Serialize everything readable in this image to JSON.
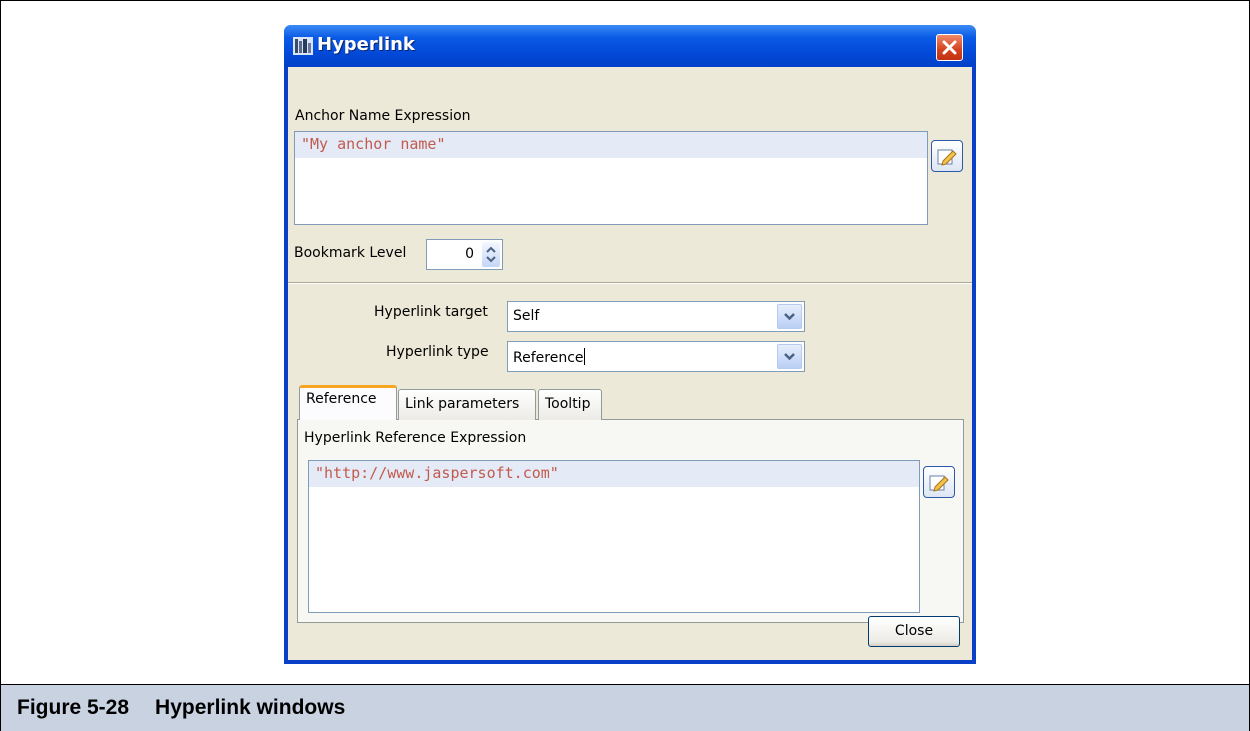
{
  "dialog": {
    "title": "Hyperlink",
    "anchor_label": "Anchor Name Expression",
    "anchor_expression": "\"My anchor name\"",
    "bookmark_label": "Bookmark Level",
    "bookmark_value": "0",
    "target_label": "Hyperlink target",
    "target_value": "Self",
    "type_label": "Hyperlink type",
    "type_value": "Reference",
    "tabs": [
      {
        "label": "Reference"
      },
      {
        "label": "Link parameters"
      },
      {
        "label": "Tooltip"
      }
    ],
    "reference_label": "Hyperlink Reference Expression",
    "reference_expression": "\"http://www.jaspersoft.com\"",
    "close_label": "Close"
  },
  "caption": {
    "number": "Figure 5-28",
    "text": "Hyperlink windows"
  },
  "colors": {
    "titlebar": "#0a5ae6",
    "expression_text": "#c25a4e",
    "caption_bg": "#c8d2e1",
    "active_tab_accent": "#f5a623"
  }
}
